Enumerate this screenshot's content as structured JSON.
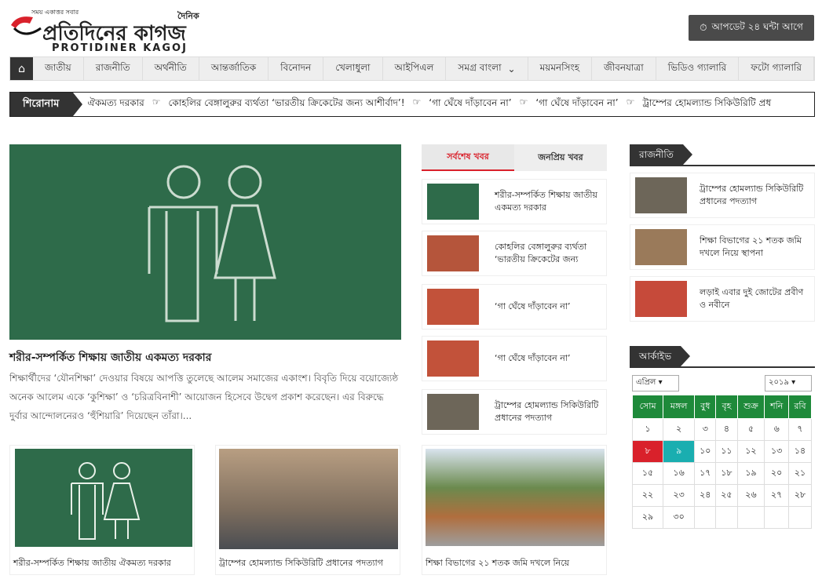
{
  "logo": {
    "tagline": "সময় একাত্তর সবার",
    "daily": "দৈনিক",
    "name_bn": "প্রতিদিনের কাগজ",
    "name_en": "PROTIDINER KAGOJ"
  },
  "update_btn": "আপডেট ২৪ ঘন্টা আগে",
  "nav": [
    "জাতীয়",
    "রাজনীতি",
    "অর্থনীতি",
    "আন্তর্জাতিক",
    "বিনোদন",
    "খেলাধুলা",
    "আইপিএল",
    "সমগ্র বাংলা",
    "ময়মনসিংহ",
    "জীবনযাত্রা",
    "ভিডিও গ্যালারি",
    "ফটো গ্যালারি"
  ],
  "ticker": {
    "label": "শিরোনাম",
    "items": [
      "ঐকমত্য দরকার",
      "কোহলির বেঙ্গালুরুর ব্যর্থতা ‘ভারতীয় ক্রিকেটের জন্য আশীর্বাদ’!",
      "‘গা ঘেঁষে দাঁড়াবেন না’",
      "‘গা ঘেঁষে দাঁড়াবেন না’",
      "ট্রাম্পের হোমল্যান্ড সিকিউরিটি প্রধ"
    ]
  },
  "hero": {
    "title": "শরীর-সম্পর্কিত শিক্ষায় জাতীয় একমত্য দরকার",
    "body": "শিক্ষার্থীদের ‘যৌনশিক্ষা’ দেওয়ার বিষয়ে আপত্তি তুলেছে আলেম সমাজের একাংশ। বিবৃতি দিয়ে বয়োজ্যেষ্ঠ অনেক আলেম একে ‘কুশিক্ষা’ ও ‘চরিত্রবিনাশী’ আয়োজন হিসেবে উদ্বেগ প্রকাশ করেছেন। এর বিরুদ্ধে দুর্বার আন্দোলনেরও ‘হুঁশিয়ারি’ দিয়েছেন তাঁরা।..."
  },
  "cards": [
    "শরীর-সম্পর্কিত শিক্ষায় জাতীয় ঐকমত্য দরকার",
    "ট্রাম্পের হোমল্যান্ড সিকিউরিটি প্রধানের পদত্যাগ",
    "শিক্ষা বিভাগের ২১ শতক জমি দখলে নিয়ে"
  ],
  "tabs": {
    "latest": "সর্বশেষ খবর",
    "popular": "জনপ্রিয় খবর"
  },
  "latest": [
    "শরীর-সম্পর্কিত শিক্ষায় জাতীয় একমত্য দরকার",
    "কোহলির বেঙ্গালুরুর ব্যর্থতা ‘ভারতীয় ক্রিকেটের জন্য",
    "‘গা ঘেঁষে দাঁড়াবেন না’",
    "‘গা ঘেঁষে দাঁড়াবেন না’",
    "ট্রাম্পের হোমল্যান্ড সিকিউরিটি প্রধানের পদত্যাগ"
  ],
  "politics": {
    "heading": "রাজনীতি",
    "items": [
      "ট্রাম্পের হোমল্যান্ড সিকিউরিটি প্রধানের পদত্যাগ",
      "শিক্ষা বিভাগের ২১ শতক জমি দখলে নিয়ে স্থাপনা",
      "লড়াই এবার দুই জোটের প্রবীণ ও নবীনে"
    ]
  },
  "archive": {
    "heading": "আর্কাইভ",
    "month": "এপ্রিল",
    "year": "২০১৯",
    "days": [
      "সোম",
      "মঙ্গল",
      "বুধ",
      "বৃহ",
      "শুক্র",
      "শনি",
      "রবি"
    ],
    "weeks": [
      [
        "১",
        "২",
        "৩",
        "৪",
        "৫",
        "৬",
        "৭"
      ],
      [
        "৮",
        "৯",
        "১০",
        "১১",
        "১২",
        "১৩",
        "১৪"
      ],
      [
        "১৫",
        "১৬",
        "১৭",
        "১৮",
        "১৯",
        "২০",
        "২১"
      ],
      [
        "২২",
        "২৩",
        "২৪",
        "২৫",
        "২৬",
        "২৭",
        "২৮"
      ],
      [
        "২৯",
        "৩০",
        "",
        "",
        "",
        "",
        ""
      ]
    ]
  },
  "colors": {
    "accent": "#d9212b",
    "board": "#2e6b4a",
    "calendar_header": "#1e8a3a",
    "today": "#1aaeb0"
  }
}
